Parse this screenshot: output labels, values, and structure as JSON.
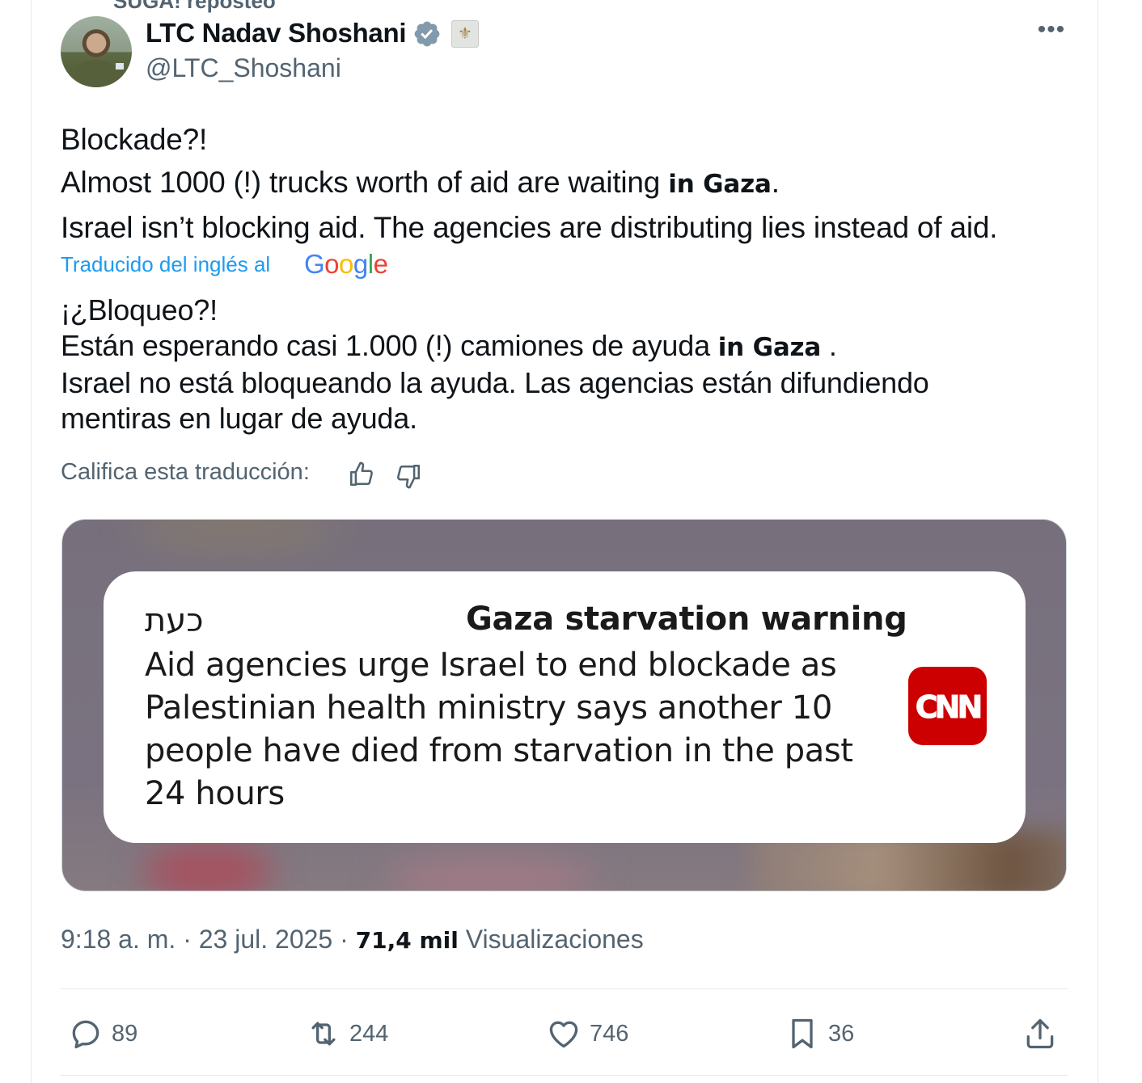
{
  "header": {
    "reposted": "SUGA! reposteó",
    "author_name": "LTC Nadav Shoshani",
    "author_handle": "@LTC_Shoshani",
    "affiliate_badge": "IDF emblem",
    "more_icon": "more-icon"
  },
  "tweet": {
    "line1": "Blockade?!",
    "line2_pre": "Almost 1000 (!) trucks worth of aid are waiting ",
    "line2_bold": "in Gaza",
    "line2_post": ".",
    "line3": "Israel isn’t blocking aid. The agencies are distributing lies instead of aid."
  },
  "translation": {
    "label": "Traducido del inglés al",
    "provider": {
      "g1": "G",
      "o1": "o",
      "o2": "o",
      "g2": "g",
      "l": "l",
      "e": "e"
    },
    "line1": "¡¿Bloqueo?!",
    "line2_pre": "Están esperando casi 1.000 (!) camiones de ayuda ",
    "line2_bold": "in Gaza",
    "line2_post": " .",
    "line3": "Israel no está bloqueando la ayuda. Las agencias están difundiendo mentiras en lugar de ayuda.",
    "rate_label": "Califica esta traducción:"
  },
  "media": {
    "notification": {
      "app_time": "כעת",
      "title": "Gaza starvation warning",
      "body": "Aid agencies urge Israel to end blockade as Palestinian health ministry says another 10 people have died from starvation in the past 24 hours",
      "logo_text": "CNN"
    }
  },
  "meta": {
    "time": "9:18 a. m.",
    "sep1": " · ",
    "date": "23 jul. 2025",
    "sep2": " · ",
    "views_count": "71,4 mil",
    "views_label": " Visualizaciones"
  },
  "actions": {
    "replies": "89",
    "reposts": "244",
    "likes": "746",
    "bookmarks": "36"
  },
  "colors": {
    "accent": "#1d9bf0",
    "secondary_text": "#536471",
    "cnn_red": "#cc0000"
  }
}
